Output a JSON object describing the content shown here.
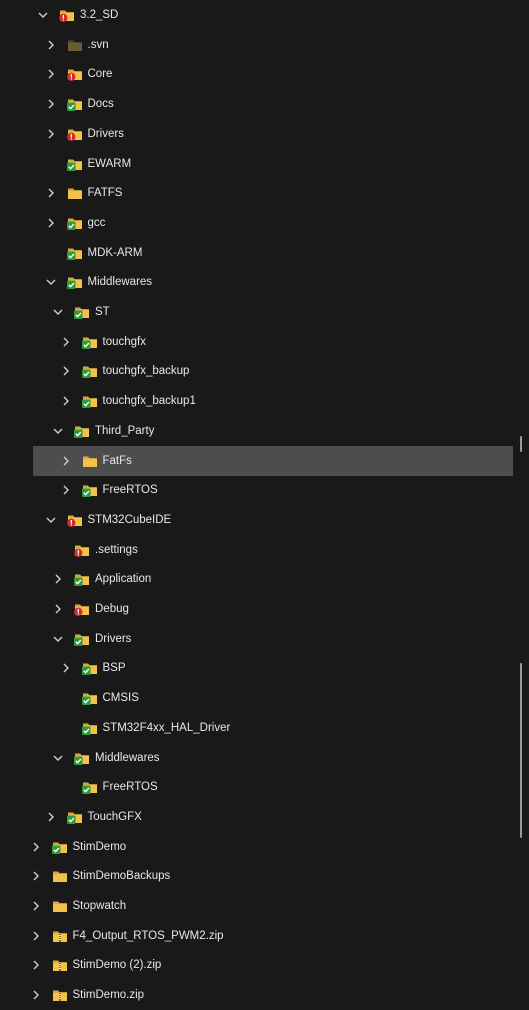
{
  "tree": [
    {
      "label": "3.2_SD",
      "depth": 0,
      "expanded": true,
      "has_chevron": true,
      "icon": "folder-warning-icon"
    },
    {
      "label": ".svn",
      "depth": 1,
      "expanded": false,
      "has_chevron": true,
      "icon": "folder-dark-icon"
    },
    {
      "label": "Core",
      "depth": 1,
      "expanded": false,
      "has_chevron": true,
      "icon": "folder-warning-icon"
    },
    {
      "label": "Docs",
      "depth": 1,
      "expanded": false,
      "has_chevron": true,
      "icon": "folder-ok-icon"
    },
    {
      "label": "Drivers",
      "depth": 1,
      "expanded": false,
      "has_chevron": true,
      "icon": "folder-warning-icon"
    },
    {
      "label": "EWARM",
      "depth": 1,
      "expanded": false,
      "has_chevron": false,
      "icon": "folder-ok-icon"
    },
    {
      "label": "FATFS",
      "depth": 1,
      "expanded": false,
      "has_chevron": true,
      "icon": "folder-icon"
    },
    {
      "label": "gcc",
      "depth": 1,
      "expanded": false,
      "has_chevron": true,
      "icon": "folder-ok-icon"
    },
    {
      "label": "MDK-ARM",
      "depth": 1,
      "expanded": false,
      "has_chevron": false,
      "icon": "folder-ok-icon"
    },
    {
      "label": "Middlewares",
      "depth": 1,
      "expanded": true,
      "has_chevron": true,
      "icon": "folder-ok-icon"
    },
    {
      "label": "ST",
      "depth": 2,
      "expanded": true,
      "has_chevron": true,
      "icon": "folder-ok-icon"
    },
    {
      "label": "touchgfx",
      "depth": 3,
      "expanded": false,
      "has_chevron": true,
      "icon": "folder-ok-icon"
    },
    {
      "label": "touchgfx_backup",
      "depth": 3,
      "expanded": false,
      "has_chevron": true,
      "icon": "folder-ok-icon"
    },
    {
      "label": "touchgfx_backup1",
      "depth": 3,
      "expanded": false,
      "has_chevron": true,
      "icon": "folder-ok-icon"
    },
    {
      "label": "Third_Party",
      "depth": 2,
      "expanded": true,
      "has_chevron": true,
      "icon": "folder-ok-icon"
    },
    {
      "label": "FatFs",
      "depth": 3,
      "expanded": false,
      "has_chevron": true,
      "icon": "folder-icon",
      "selected": true
    },
    {
      "label": "FreeRTOS",
      "depth": 3,
      "expanded": false,
      "has_chevron": true,
      "icon": "folder-ok-icon"
    },
    {
      "label": "STM32CubeIDE",
      "depth": 1,
      "expanded": true,
      "has_chevron": true,
      "icon": "folder-warning-icon"
    },
    {
      "label": ".settings",
      "depth": 2,
      "expanded": false,
      "has_chevron": false,
      "icon": "folder-warning-icon"
    },
    {
      "label": "Application",
      "depth": 2,
      "expanded": false,
      "has_chevron": true,
      "icon": "folder-ok-icon"
    },
    {
      "label": "Debug",
      "depth": 2,
      "expanded": false,
      "has_chevron": true,
      "icon": "folder-warning-icon"
    },
    {
      "label": "Drivers",
      "depth": 2,
      "expanded": true,
      "has_chevron": true,
      "icon": "folder-ok-icon"
    },
    {
      "label": "BSP",
      "depth": 3,
      "expanded": false,
      "has_chevron": true,
      "icon": "folder-ok-icon"
    },
    {
      "label": "CMSIS",
      "depth": 3,
      "expanded": false,
      "has_chevron": false,
      "icon": "folder-ok-icon"
    },
    {
      "label": "STM32F4xx_HAL_Driver",
      "depth": 3,
      "expanded": false,
      "has_chevron": false,
      "icon": "folder-ok-icon"
    },
    {
      "label": "Middlewares",
      "depth": 2,
      "expanded": true,
      "has_chevron": true,
      "icon": "folder-ok-icon"
    },
    {
      "label": "FreeRTOS",
      "depth": 3,
      "expanded": false,
      "has_chevron": false,
      "icon": "folder-ok-icon"
    },
    {
      "label": "TouchGFX",
      "depth": 1,
      "expanded": false,
      "has_chevron": true,
      "icon": "folder-ok-icon"
    },
    {
      "label": "StimDemo",
      "depth": -1,
      "expanded": false,
      "has_chevron": true,
      "icon": "folder-ok-icon"
    },
    {
      "label": "StimDemoBackups",
      "depth": -1,
      "expanded": false,
      "has_chevron": true,
      "icon": "folder-icon"
    },
    {
      "label": "Stopwatch",
      "depth": -1,
      "expanded": false,
      "has_chevron": true,
      "icon": "folder-icon"
    },
    {
      "label": "F4_Output_RTOS_PWM2.zip",
      "depth": -1,
      "expanded": false,
      "has_chevron": true,
      "icon": "zip-folder-icon"
    },
    {
      "label": "StimDemo (2).zip",
      "depth": -1,
      "expanded": false,
      "has_chevron": true,
      "icon": "zip-folder-icon"
    },
    {
      "label": "StimDemo.zip",
      "depth": -1,
      "expanded": false,
      "has_chevron": true,
      "icon": "zip-folder-icon"
    }
  ],
  "colors": {
    "background": "#191919",
    "selected_row": "#4d4d4d",
    "folder": "#f3c24b",
    "folder_dark": "#6b5a32",
    "badge_ok": "#2e9b3a",
    "badge_warning": "#d12b2b"
  }
}
